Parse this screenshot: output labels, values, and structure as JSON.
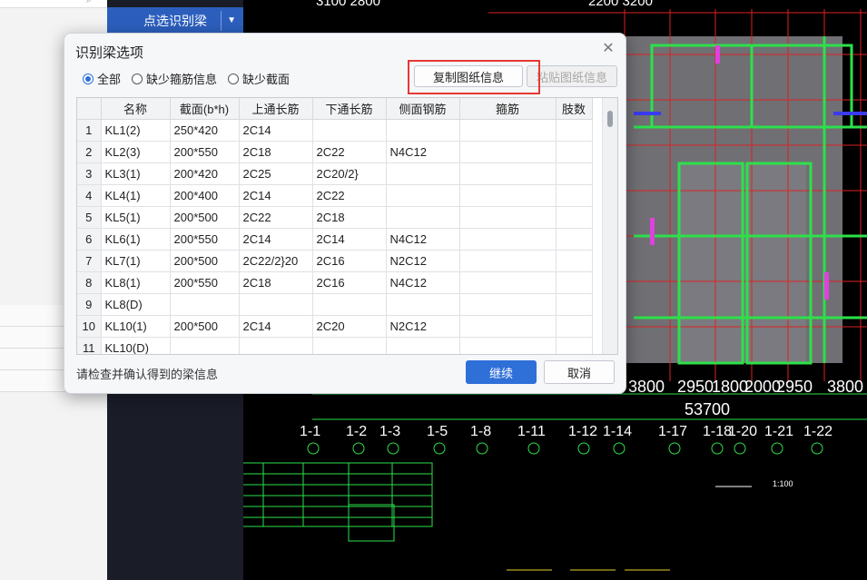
{
  "sidebar": {
    "command_button": "点选识别梁"
  },
  "dialog": {
    "title": "识别梁选项",
    "radios": [
      {
        "label": "全部",
        "selected": true
      },
      {
        "label": "缺少箍筋信息",
        "selected": false
      },
      {
        "label": "缺少截面",
        "selected": false
      }
    ],
    "copy_button": "复制图纸信息",
    "paste_button": "粘贴图纸信息",
    "columns": [
      "名称",
      "截面(b*h)",
      "上通长筋",
      "下通长筋",
      "侧面钢筋",
      "箍筋",
      "肢数"
    ],
    "rows": [
      {
        "index": "1",
        "cells": [
          "KL1(2)",
          "250*420",
          "2C14",
          "",
          "",
          "",
          ""
        ]
      },
      {
        "index": "2",
        "cells": [
          "KL2(3)",
          "200*550",
          "2C18",
          "2C22",
          "N4C12",
          "",
          ""
        ]
      },
      {
        "index": "3",
        "cells": [
          "KL3(1)",
          "200*420",
          "2C25",
          "2C20/2}",
          "",
          "",
          ""
        ]
      },
      {
        "index": "4",
        "cells": [
          "KL4(1)",
          "200*400",
          "2C14",
          "2C22",
          "",
          "",
          ""
        ]
      },
      {
        "index": "5",
        "cells": [
          "KL5(1)",
          "200*500",
          "2C22",
          "2C18",
          "",
          "",
          ""
        ]
      },
      {
        "index": "6",
        "cells": [
          "KL6(1)",
          "200*550",
          "2C14",
          "2C14",
          "N4C12",
          "",
          ""
        ]
      },
      {
        "index": "7",
        "cells": [
          "KL7(1)",
          "200*500",
          "2C22/2}20",
          "2C16",
          "N2C12",
          "",
          ""
        ]
      },
      {
        "index": "8",
        "cells": [
          "KL8(1)",
          "200*550",
          "2C18",
          "2C16",
          "N4C12",
          "",
          ""
        ]
      },
      {
        "index": "9",
        "cells": [
          "KL8(D)",
          "",
          "",
          "",
          "",
          "",
          ""
        ]
      },
      {
        "index": "10",
        "cells": [
          "KL10(1)",
          "200*500",
          "2C14",
          "2C20",
          "N2C12",
          "",
          ""
        ]
      },
      {
        "index": "11",
        "cells": [
          "KL10(D)",
          "",
          "",
          "",
          "",
          "",
          ""
        ]
      }
    ],
    "footer_note": "请检查并确认得到的梁信息",
    "ok_button": "继续",
    "cancel_button": "取消"
  },
  "cad": {
    "top_dims": "3100  2800",
    "top_dims_right": "2200 3200",
    "dim_left": "3800",
    "dim_mid": "2950",
    "dim_mid2": "1800",
    "dim_mid3": "2000",
    "dim_mid4": "2950",
    "dim_right": "3800",
    "total_dim": "53700",
    "axis_labels": [
      "1-1",
      "1-2",
      "1-3",
      "1-5",
      "1-8",
      "1-11",
      "1-12",
      "1-14",
      "1-17",
      "1-18",
      "1-20",
      "1-21",
      "1-22"
    ],
    "scale_note": "1:100"
  }
}
